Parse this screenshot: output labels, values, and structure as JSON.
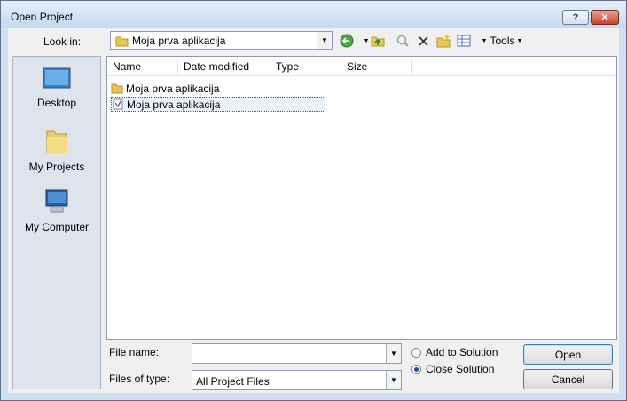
{
  "window": {
    "title": "Open Project"
  },
  "toolbar": {
    "look_in_label": "Look in:",
    "look_in_value": "Moja prva aplikacija",
    "tools_label": "Tools"
  },
  "places": [
    {
      "label": "Desktop",
      "icon": "desktop-icon"
    },
    {
      "label": "My Projects",
      "icon": "folder-icon"
    },
    {
      "label": "My Computer",
      "icon": "computer-icon"
    }
  ],
  "file_list": {
    "columns": [
      "Name",
      "Date modified",
      "Type",
      "Size"
    ],
    "rows": [
      {
        "name": "Moja prva aplikacija",
        "icon": "folder-icon",
        "selected": false
      },
      {
        "name": "Moja prva aplikacija",
        "icon": "solution-file-icon",
        "selected": true
      }
    ]
  },
  "form": {
    "file_name_label": "File name:",
    "file_name_value": "",
    "files_of_type_label": "Files of type:",
    "files_of_type_value": "All Project Files",
    "radio_add": "Add to Solution",
    "radio_close": "Close Solution",
    "selected_radio": "close"
  },
  "buttons": {
    "open": "Open",
    "cancel": "Cancel"
  },
  "colors": {
    "title_bar": "#c5d9ef",
    "close_button": "#c7432c",
    "selection": "#2b62c2"
  }
}
